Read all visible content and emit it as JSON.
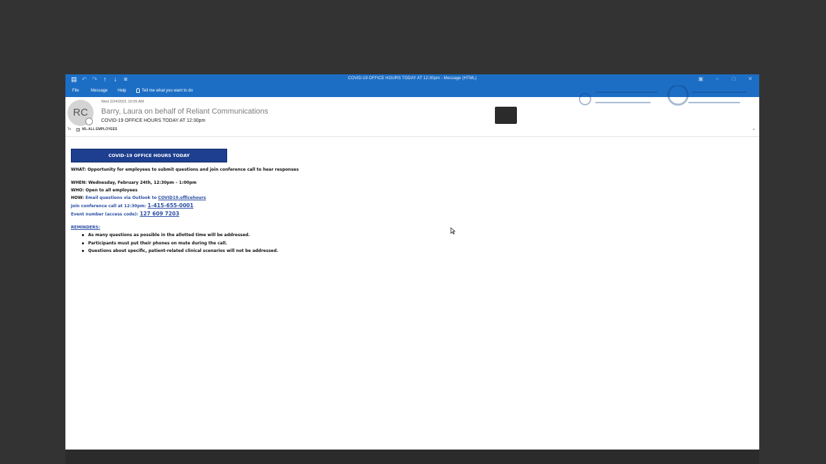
{
  "window": {
    "title": "COVID-19 OFFICE HOURS TODAY AT 12:30pm  -  Message (HTML)",
    "quick_access_icons": [
      "save-icon",
      "undo-icon",
      "redo-icon",
      "up-arrow-icon",
      "down-arrow-icon",
      "customize-icon"
    ],
    "controls": [
      "ribbon-display-icon",
      "minimize-icon",
      "maximize-icon",
      "close-icon"
    ]
  },
  "ribbon": {
    "tabs": [
      "File",
      "Message",
      "Help"
    ],
    "tell_me": "Tell me what you want to do"
  },
  "message": {
    "avatar_initials": "RC",
    "date": "Wed 2/24/2021 10:05 AM",
    "sender": "Barry, Laura on behalf of Reliant Communications",
    "subject": "COVID-19 OFFICE HOURS TODAY AT 12:30pm",
    "to_label": "To",
    "recipient": "ML-ALL EMPLOYEES",
    "collapse_glyph": "⌃"
  },
  "body": {
    "banner": "COVID-19 OFFICE HOURS TODAY",
    "what": "WHAT: Opportunity for employees to submit questions and join conference call to hear responses",
    "when": "WHEN: Wednesday, February 24th, 12:30pm – 1:00pm",
    "who": "WHO: Open to all employees",
    "how_label": "HOW:",
    "how_text": "Email questions via Outlook to",
    "how_link": "COVID19.officehours",
    "join_label": "Join conference call at 12:30pm:",
    "join_number": "1-415-655-0001",
    "event_label": "Event number (access code):",
    "event_number": "127 609 7203",
    "reminders_label": "REMINDERS:",
    "reminders": [
      "As many questions as possible in the allotted time will be addressed.",
      "Participants must put their phones on mute during the call.",
      "Questions about specific, patient-related clinical scenarios will not be addressed."
    ]
  },
  "colors": {
    "titlebar": "#1c6ec5",
    "banner": "#1e3f8f",
    "link": "#2b4fa5",
    "background": "#333333"
  }
}
